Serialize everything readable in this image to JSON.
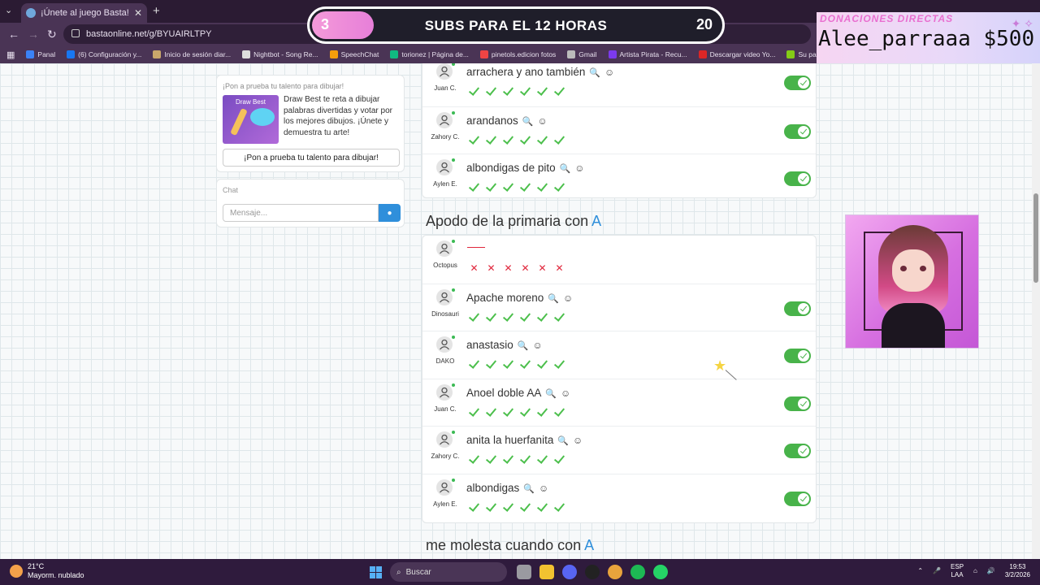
{
  "browser": {
    "tab_title": "¡Únete al juego Basta!",
    "url": "bastaonline.net/g/BYUAIRLTPY",
    "bookmarks": [
      "Panal",
      "(6) Configuración y...",
      "Inicio de sesión diar...",
      "Nightbot - Song Re...",
      "SpeechChat",
      "torionez | Página de...",
      "pinetols.edicion fotos",
      "Gmail",
      "Artista Pirata - Recu...",
      "Descargar video Yo...",
      "Su panel de control..."
    ]
  },
  "overlay": {
    "subs_current": "3",
    "subs_title": "SUBS PARA EL 12 HORAS",
    "subs_goal": "20",
    "subs_progress": 0.15,
    "donations_title": "DONACIONES DIRECTAS",
    "donations_amount": "Alee_parraaa $500"
  },
  "promo": {
    "heading": "¡Pon a prueba tu talento para dibujar!",
    "image_label": "Draw Best",
    "description": "Draw Best te reta a dibujar palabras divertidas y votar por los mejores dibujos. ¡Únete y demuestra tu arte!",
    "button": "¡Pon a prueba tu talento para dibujar!"
  },
  "chat": {
    "label": "Chat",
    "placeholder": "Mensaje..."
  },
  "section1": {
    "rows": [
      {
        "user": "Juan C.",
        "answer": "arrachera y ano también"
      },
      {
        "user": "Zahory C.",
        "answer": "arandanos"
      },
      {
        "user": "Aylen E.",
        "answer": "albondigas de pito"
      }
    ]
  },
  "section2": {
    "title": "Apodo de la primaria con",
    "letter": "A",
    "rows": [
      {
        "user": "Octopus",
        "answer": "",
        "valid": false
      },
      {
        "user": "Dinosauri",
        "answer": "Apache moreno",
        "valid": true
      },
      {
        "user": "DAKO",
        "answer": "anastasio",
        "valid": true
      },
      {
        "user": "Juan C.",
        "answer": "Anoel doble AA",
        "valid": true
      },
      {
        "user": "Zahory C.",
        "answer": "anita la huerfanita",
        "valid": true
      },
      {
        "user": "Aylen E.",
        "answer": "albondigas",
        "valid": true
      }
    ]
  },
  "section3": {
    "title": "me molesta cuando con",
    "letter": "A"
  },
  "taskbar": {
    "temp": "21°C",
    "weather": "Mayorm. nublado",
    "search": "Buscar",
    "lang1": "ESP",
    "lang2": "LAA",
    "time": "19:53",
    "date": "3/2/2026"
  },
  "colors": {
    "accent": "#2f8fdb",
    "ok": "#4cbf4c",
    "error": "#e0263b"
  }
}
